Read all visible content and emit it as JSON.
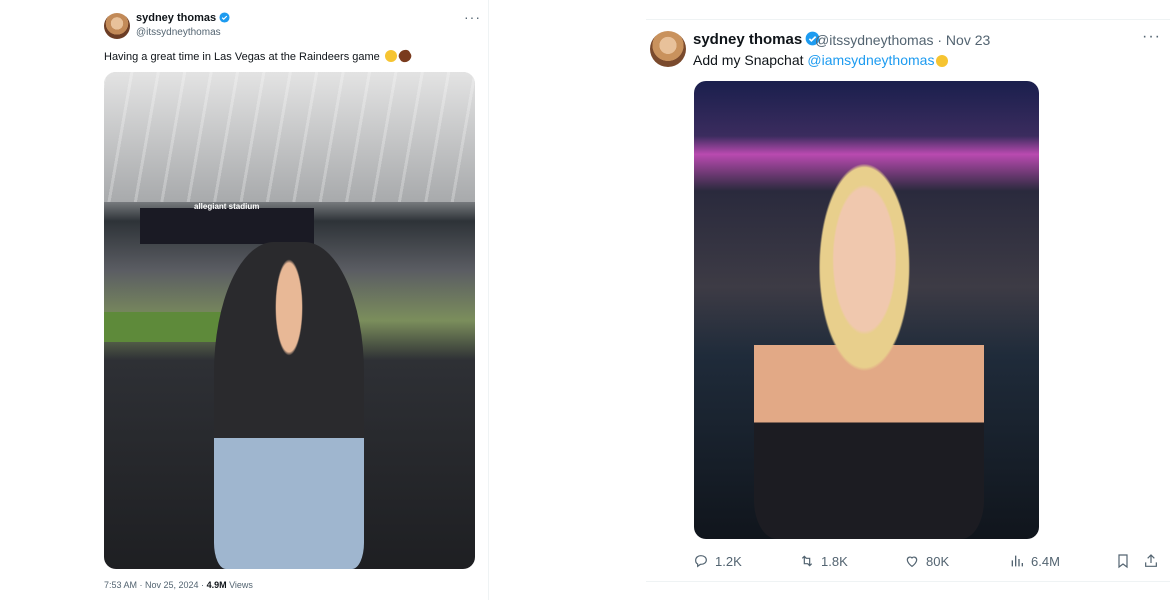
{
  "tweet_left": {
    "display_name": "sydney thomas",
    "handle": "@itssydneythomas",
    "text": "Having a great time in Las Vegas at the Raindeers game",
    "photo_sign": "allegiant stadium",
    "timestamp": "7:53 AM · Nov 25, 2024 · ",
    "views_count": "4.9M",
    "views_label": " Views"
  },
  "tweet_right": {
    "display_name": "sydney thomas",
    "handle_and_date": "@itssydneythomas · Nov 23",
    "text_prefix": "Add my Snapchat ",
    "text_link": "@iamsydneythomas",
    "actions": {
      "replies": "1.2K",
      "reposts": "1.8K",
      "likes": "80K",
      "views": "6.4M"
    }
  },
  "icons": [
    "verified-badge-icon",
    "more-icon",
    "reply-icon",
    "repost-icon",
    "like-icon",
    "views-icon",
    "bookmark-icon",
    "share-icon"
  ],
  "colors": {
    "accent": "#1d9bf0",
    "secondary_text": "#536471",
    "divider": "#eff3f4"
  }
}
